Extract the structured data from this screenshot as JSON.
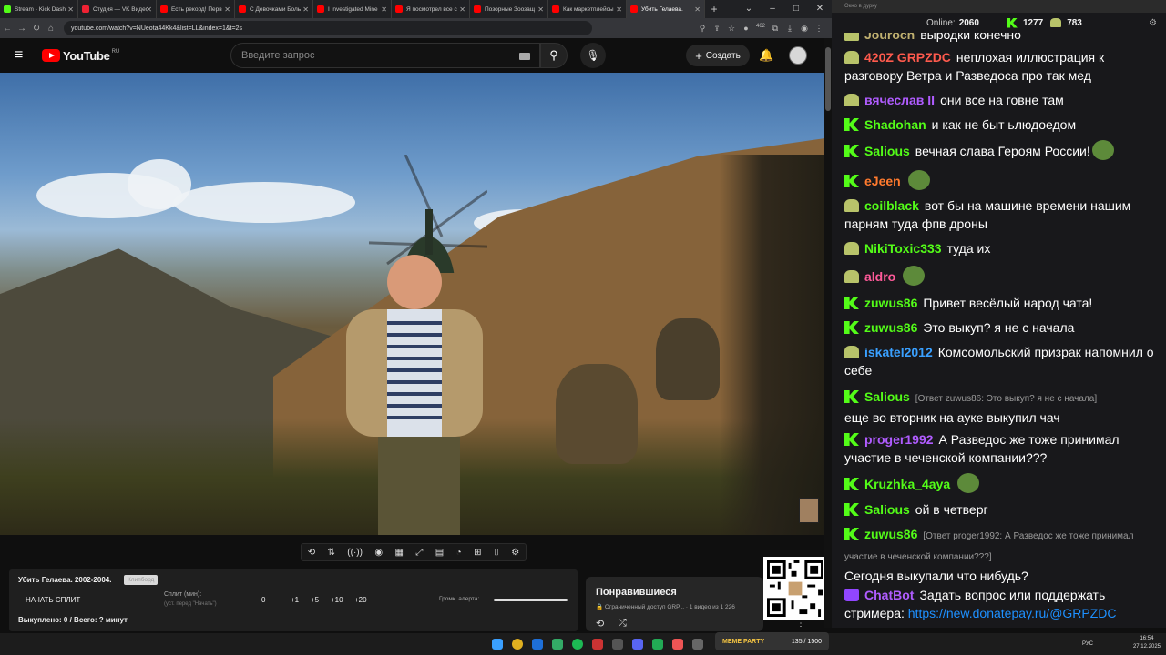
{
  "browser": {
    "tabs": [
      {
        "title": "Stream - Kick Dash",
        "color": "#53fc18"
      },
      {
        "title": "Студия — VK Видео",
        "color": "#e23"
      },
      {
        "title": "Есть рекорд! Перв",
        "color": "#ff0000"
      },
      {
        "title": "С Девочками Боль",
        "color": "#ff0000"
      },
      {
        "title": "I Investigated Mine",
        "color": "#ff0000"
      },
      {
        "title": "Я посмотрел все с",
        "color": "#ff0000"
      },
      {
        "title": "Позорные Зоозащ",
        "color": "#ff0000"
      },
      {
        "title": "Как маркетплейсы",
        "color": "#ff0000"
      },
      {
        "title": "Убить Гелаева.",
        "color": "#ff0000"
      }
    ],
    "url": "youtube.com/watch?v=NUeota44Kk4&list=LL&index=1&t=2s",
    "ext_badge": "462"
  },
  "youtube": {
    "logo": "YouTube",
    "region": "RU",
    "search_placeholder": "Введите запрос",
    "create_label": "Создать"
  },
  "split": {
    "title": "Убить Гелаева. 2002-2004.",
    "copy_tag": "Клипборд",
    "start": "НАЧАТЬ СПЛИТ",
    "split_label": "Сплит (мин):",
    "split_sub": "(уст. перед \"Начать\")",
    "value": "0",
    "steps": [
      "+1",
      "+5",
      "+10",
      "+20"
    ],
    "alert_label": "Громк. алерта:",
    "bought": "Выкуплено: 0 / Всего: ? минут"
  },
  "liked": {
    "heading": "Понравившиеся",
    "meta": "Ограниченный доступ GRP...",
    "count": "1 видео из 1 226"
  },
  "chat": {
    "window_title": "Окно в дурку",
    "online_label": "Online:",
    "online": "2060",
    "kick_count": "1277",
    "rumble_count": "783",
    "messages": [
      {
        "icon": "g",
        "user": "Jouroch",
        "color": "#c0b070",
        "text": "выродки конечно"
      },
      {
        "icon": "g",
        "user": "420Z GRPZDC",
        "color": "#ff5a4d",
        "text": "неплохая иллюстрация к разговору Ветра и Разведоса про так мед"
      },
      {
        "icon": "g",
        "user": "вячеслав II",
        "color": "#b05cff",
        "text": "они все на говне там"
      },
      {
        "icon": "k",
        "user": "Shadohan",
        "color": "#53fc18",
        "text": "и как не быт ьлюдоедом"
      },
      {
        "icon": "k",
        "user": "Salious",
        "color": "#53fc18",
        "text": "вечная слава Героям России!"
      },
      {
        "icon": "k",
        "user": "eJeen",
        "color": "#ff7a2e",
        "text": ""
      },
      {
        "icon": "g",
        "user": "coilblack",
        "color": "#53fc18",
        "text": "вот бы на машине времени нашим парням туда фпв дроны"
      },
      {
        "icon": "g",
        "user": "NikiToxic333",
        "color": "#53fc18",
        "text": "туда их"
      },
      {
        "icon": "g",
        "user": "aldro",
        "color": "#ff5a9a",
        "text": ""
      },
      {
        "icon": "k",
        "user": "zuwus86",
        "color": "#53fc18",
        "text": "Привет весёлый народ чата!"
      },
      {
        "icon": "k",
        "user": "zuwus86",
        "color": "#53fc18",
        "text": "Это выкуп? я не с начала"
      },
      {
        "icon": "g",
        "user": "iskatel2012",
        "color": "#3aa0ff",
        "text": "Комсомольский призрак напомнил о себе"
      },
      {
        "icon": "k",
        "user": "Salious",
        "color": "#53fc18",
        "reply": "[Ответ zuwus86: Это выкуп? я не с начала]",
        "text": "еще во вторник на ауке выкупил чач"
      },
      {
        "icon": "k",
        "user": "proger1992",
        "color": "#b05cff",
        "text": "А Разведос же тоже принимал участие в чеченской компании???"
      },
      {
        "icon": "k",
        "user": "Kruzhka_4aya",
        "color": "#53fc18",
        "text": ""
      },
      {
        "icon": "k",
        "user": "Salious",
        "color": "#53fc18",
        "text": "ой в четверг"
      },
      {
        "icon": "k",
        "user": "zuwus86",
        "color": "#53fc18",
        "reply": "[Ответ proger1992: А Разведос же тоже принимал участие в чеченской компании???]",
        "text": "Сегодня выкупали что нибудь?"
      },
      {
        "icon": "c",
        "user": "ChatBot",
        "color": "#b05cff",
        "text": "Задать вопрос или поддержать стримера:",
        "link": "https://new.donatepay.ru/@GRPZDC"
      }
    ]
  },
  "taskbar": {
    "lang": "РУС",
    "time": "16:54",
    "date": "27.12.2025",
    "meme_label": "MEME PARTY",
    "meme_count": "135 / 1500"
  }
}
